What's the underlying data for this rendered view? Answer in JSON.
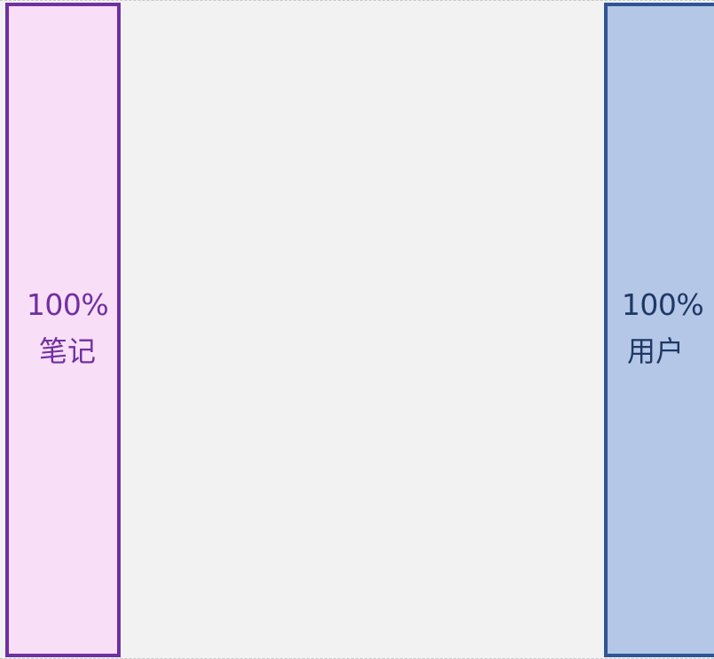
{
  "segments": [
    {
      "percent": "100%",
      "label": "笔记",
      "fill": "#f8def6",
      "border": "#7030a0",
      "text_color": "#7030a0"
    },
    {
      "percent": "100%",
      "label": "用户",
      "fill": "#b4c7e7",
      "border": "#2f5597",
      "text_color": "#1f3864"
    }
  ]
}
